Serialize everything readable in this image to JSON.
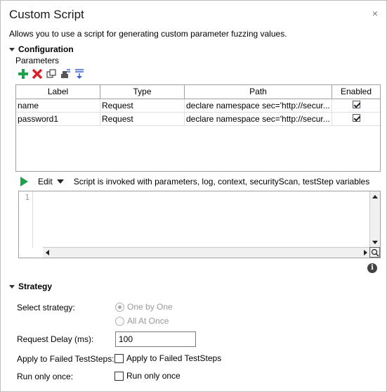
{
  "window": {
    "title": "Custom Script",
    "close_glyph": "×",
    "description": "Allows you to use a script for generating custom parameter fuzzing values."
  },
  "configuration": {
    "header": "Configuration",
    "parameters_label": "Parameters",
    "toolbar": [
      "add-icon",
      "delete-icon",
      "copy-icon",
      "extract-icon",
      "sort-icon"
    ],
    "table": {
      "columns": [
        "Label",
        "Type",
        "Path",
        "Enabled"
      ],
      "rows": [
        {
          "label": "name",
          "type": "Request",
          "path": "declare namespace sec='http://secur...",
          "enabled": true
        },
        {
          "label": "password1",
          "type": "Request",
          "path": "declare namespace sec='http://secur...",
          "enabled": true
        }
      ]
    },
    "script": {
      "edit_label": "Edit",
      "hint": "Script is invoked with parameters, log, context, securityScan, testStep variables",
      "line_number": "1"
    }
  },
  "strategy": {
    "header": "Strategy",
    "select_label": "Select strategy:",
    "option_one": "One by One",
    "option_all": "All At Once",
    "delay_label": "Request Delay (ms):",
    "delay_value": "100",
    "apply_label": "Apply to Failed TestSteps:",
    "apply_checkbox": "Apply to Failed TestSteps",
    "run_label": "Run only once:",
    "run_checkbox": "Run only once"
  },
  "colors": {
    "add": "#1fa34a",
    "delete": "#d8232a",
    "run": "#1fa34a"
  }
}
